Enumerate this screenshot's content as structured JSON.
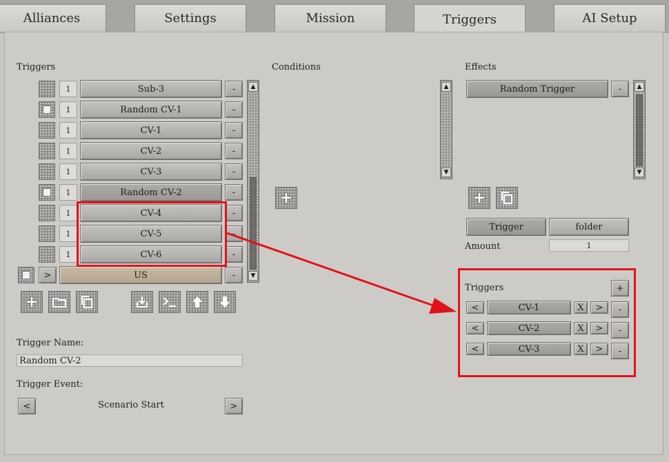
{
  "tabs": [
    "Alliances",
    "Settings",
    "Mission",
    "Triggers",
    "AI Setup"
  ],
  "active_tab": "Triggers",
  "triggers": {
    "heading": "Triggers",
    "items": [
      {
        "count": "1",
        "name": "Sub-3",
        "checked": false
      },
      {
        "count": "1",
        "name": "Random CV-1",
        "checked": true
      },
      {
        "count": "1",
        "name": "CV-1",
        "checked": false
      },
      {
        "count": "1",
        "name": "CV-2",
        "checked": false
      },
      {
        "count": "1",
        "name": "CV-3",
        "checked": false
      },
      {
        "count": "1",
        "name": "Random CV-2",
        "checked": true
      },
      {
        "count": "1",
        "name": "CV-4",
        "checked": false
      },
      {
        "count": "1",
        "name": "CV-5",
        "checked": false
      },
      {
        "count": "1",
        "name": "CV-6",
        "checked": false
      }
    ],
    "remove_label": "-",
    "folder": {
      "expand_label": ">",
      "name": "US",
      "checked": true
    }
  },
  "toolbar_icons": [
    "add-icon",
    "folder-icon",
    "copy-icon",
    "import-icon",
    "console-icon",
    "arrow-up-icon",
    "arrow-down-icon"
  ],
  "trigger_name": {
    "label": "Trigger Name:",
    "value": "Random CV-2"
  },
  "trigger_event": {
    "label": "Trigger Event:",
    "prev": "<",
    "value": "Scenario Start",
    "next": ">"
  },
  "conditions": {
    "heading": "Conditions",
    "add_icon": "add-icon"
  },
  "effects": {
    "heading": "Effects",
    "items": [
      {
        "name": "Random Trigger"
      }
    ],
    "remove_label": "-",
    "add_icon": "add-icon",
    "copy_icon": "copy-icon",
    "type_buttons": [
      "Trigger",
      "folder"
    ],
    "amount_label": "Amount",
    "amount_value": "1",
    "sub_triggers": {
      "heading": "Triggers",
      "add_label": "+",
      "rows": [
        {
          "prev": "<",
          "name": "CV-1",
          "close": "X",
          "next": ">",
          "remove": "-"
        },
        {
          "prev": "<",
          "name": "CV-2",
          "close": "X",
          "next": ">",
          "remove": "-"
        },
        {
          "prev": "<",
          "name": "CV-3",
          "close": "X",
          "next": ">",
          "remove": "-"
        }
      ]
    }
  },
  "colors": {
    "highlight": "#e2121a"
  }
}
